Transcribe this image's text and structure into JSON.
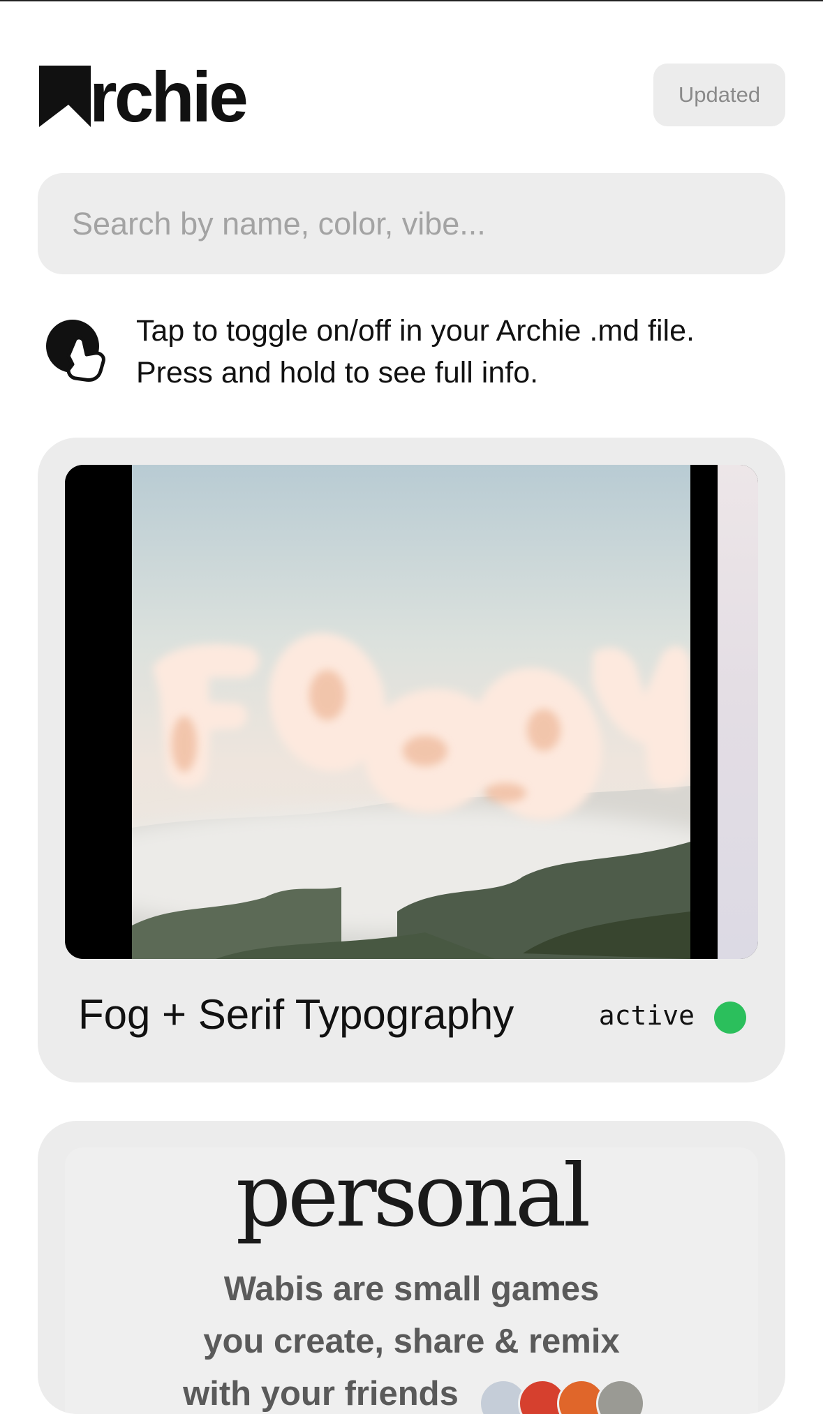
{
  "header": {
    "logo_text": "rchie",
    "logo_full": "Archie",
    "updated_label": "Updated"
  },
  "search": {
    "placeholder": "Search by name, color, vibe...",
    "value": ""
  },
  "hint": {
    "line1": "Tap to toggle on/off in your Archie .md file.",
    "line2": "Press and hold to see full info."
  },
  "cards": [
    {
      "title": "Fog + Serif Typography",
      "image_text": "Foggy",
      "status": "active",
      "status_color": "#2bbf5c"
    },
    {
      "preview_title": "personal",
      "preview_lines": [
        "Wabis are small games",
        "you create, share & remix",
        "with your friends"
      ]
    }
  ],
  "colors": {
    "card_bg": "#ececec",
    "search_bg": "#ededed",
    "accent_green": "#2bbf5c"
  }
}
